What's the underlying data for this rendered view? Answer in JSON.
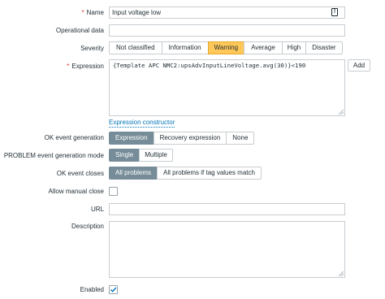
{
  "name": {
    "label": "Name",
    "value": "Input voltage low",
    "icon": "macro-icon"
  },
  "operational_data": {
    "label": "Operational data",
    "value": ""
  },
  "severity": {
    "label": "Severity",
    "options": [
      "Not classified",
      "Information",
      "Warning",
      "Average",
      "High",
      "Disaster"
    ],
    "selected": "Warning",
    "selected_color": "#ffc859"
  },
  "expression": {
    "label": "Expression",
    "value": "{Template APC NMC2:upsAdvInputLineVoltage.avg(30)}<190",
    "add_label": "Add",
    "constructor_link": "Expression constructor"
  },
  "ok_event_generation": {
    "label": "OK event generation",
    "options": [
      "Expression",
      "Recovery expression",
      "None"
    ],
    "selected": "Expression"
  },
  "problem_mode": {
    "label": "PROBLEM event generation mode",
    "options": [
      "Single",
      "Multiple"
    ],
    "selected": "Single"
  },
  "ok_event_closes": {
    "label": "OK event closes",
    "options": [
      "All problems",
      "All problems if tag values match"
    ],
    "selected": "All problems"
  },
  "allow_manual_close": {
    "label": "Allow manual close",
    "checked": false
  },
  "url": {
    "label": "URL",
    "value": ""
  },
  "description": {
    "label": "Description",
    "value": ""
  },
  "enabled": {
    "label": "Enabled",
    "checked": true
  },
  "colors": {
    "selected_segment": "#768d99",
    "link": "#0275b8",
    "required_star": "#e33734"
  }
}
